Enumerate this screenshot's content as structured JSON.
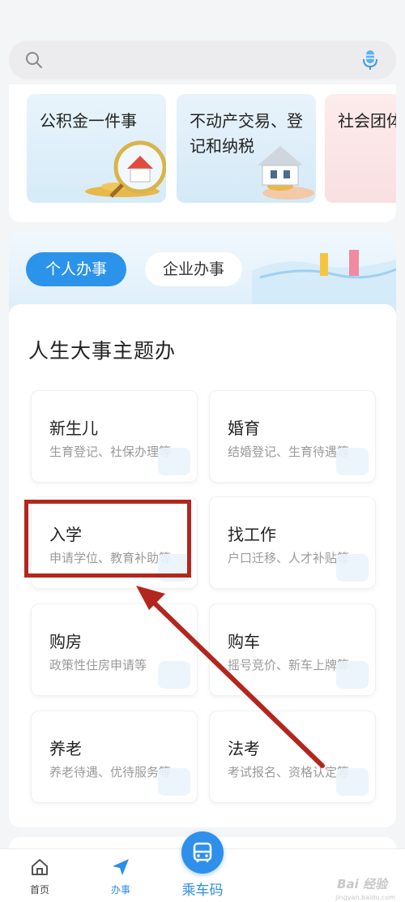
{
  "search": {
    "placeholder": ""
  },
  "service_cards": [
    {
      "label": "公积金一件事"
    },
    {
      "label": "不动产交易、登记和纳税"
    },
    {
      "label": "社会团体"
    }
  ],
  "tabs": [
    {
      "label": "个人办事",
      "active": true
    },
    {
      "label": "企业办事",
      "active": false
    }
  ],
  "section": {
    "title": "人生大事主题办"
  },
  "tiles": [
    {
      "name": "新生儿",
      "desc": "生育登记、社保办理等"
    },
    {
      "name": "婚育",
      "desc": "结婚登记、生育待遇等"
    },
    {
      "name": "入学",
      "desc": "申请学位、教育补助等"
    },
    {
      "name": "找工作",
      "desc": "户口迁移、人才补贴等"
    },
    {
      "name": "购房",
      "desc": "政策性住房申请等"
    },
    {
      "name": "购车",
      "desc": "摇号竞价、新车上牌等"
    },
    {
      "name": "养老",
      "desc": "养老待遇、优待服务等"
    },
    {
      "name": "法考",
      "desc": "考试报名、资格认定等"
    }
  ],
  "bottom_nav": {
    "home": "首页",
    "service": "办事",
    "bus_code": "乘车码"
  },
  "colors": {
    "accent": "#2c93ea",
    "highlight": "#b3261e"
  },
  "watermark": {
    "text": "Bai 经验",
    "sub": "jingyan.baidu.com"
  }
}
